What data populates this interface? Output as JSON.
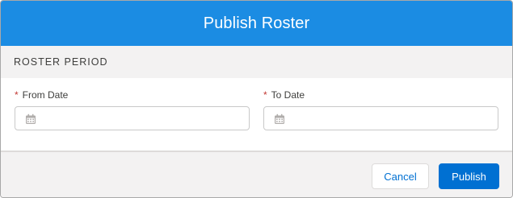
{
  "modal": {
    "title": "Publish Roster"
  },
  "section": {
    "title": "ROSTER PERIOD"
  },
  "fields": {
    "from": {
      "required_mark": "*",
      "label": "From Date",
      "value": "",
      "icon": "calendar-icon"
    },
    "to": {
      "required_mark": "*",
      "label": "To Date",
      "value": "",
      "icon": "calendar-icon"
    }
  },
  "footer": {
    "cancel_label": "Cancel",
    "publish_label": "Publish"
  },
  "colors": {
    "header_bg": "#1b8ce3",
    "primary_button": "#0070d2",
    "required": "#c23934"
  }
}
